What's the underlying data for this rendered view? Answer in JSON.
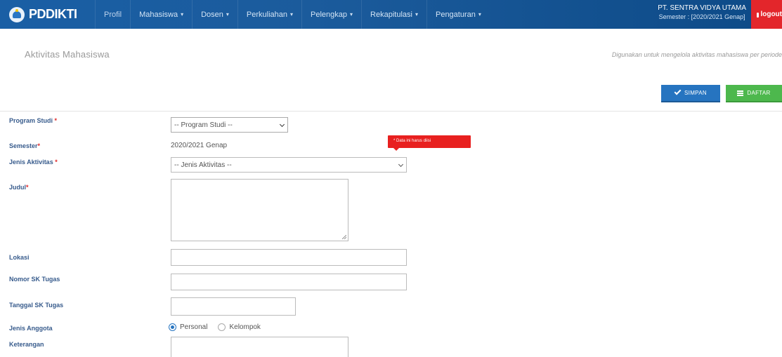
{
  "brand": {
    "name": "PDDIKTI"
  },
  "nav": {
    "items": [
      {
        "label": "Profil",
        "dropdown": false
      },
      {
        "label": "Mahasiswa",
        "dropdown": true
      },
      {
        "label": "Dosen",
        "dropdown": true
      },
      {
        "label": "Perkuliahan",
        "dropdown": true
      },
      {
        "label": "Pelengkap",
        "dropdown": true
      },
      {
        "label": "Rekapitulasi",
        "dropdown": true
      },
      {
        "label": "Pengaturan",
        "dropdown": true
      }
    ],
    "caret": "▾"
  },
  "user": {
    "institution": "PT. SENTRA VIDYA UTAMA",
    "semester": "Semester : [2020/2021 Genap]",
    "logout_label": "logout"
  },
  "page": {
    "title": "Aktivitas Mahasiswa",
    "description": "Digunakan untuk mengelola aktivitas mahasiswa per periode"
  },
  "actions": {
    "save_label": "SIMPAN",
    "list_label": "DAFTAR"
  },
  "form": {
    "program_studi": {
      "label": "Program Studi",
      "required": "*",
      "value": "-- Program Studi --"
    },
    "semester": {
      "label": "Semester",
      "required": "*",
      "value": "2020/2021 Genap"
    },
    "jenis_aktivitas": {
      "label": "Jenis Aktivitas",
      "required": "*",
      "value": "-- Jenis Aktivitas --"
    },
    "judul": {
      "label": "Judul",
      "required": "*"
    },
    "lokasi": {
      "label": "Lokasi"
    },
    "nomor_sk": {
      "label": "Nomor SK Tugas"
    },
    "tanggal_sk": {
      "label": "Tanggal SK Tugas"
    },
    "jenis_anggota": {
      "label": "Jenis Anggota",
      "options": [
        "Personal",
        "Kelompok"
      ],
      "selected": "Personal"
    },
    "keterangan": {
      "label": "Keterangan"
    }
  },
  "validation": {
    "message": "* Data ini harus diisi"
  },
  "colors": {
    "navbar": "#1b5b9c",
    "save": "#2674c0",
    "list": "#4db84d",
    "logout": "#e3262b",
    "error": "#e8201f",
    "label": "#375b8c"
  }
}
